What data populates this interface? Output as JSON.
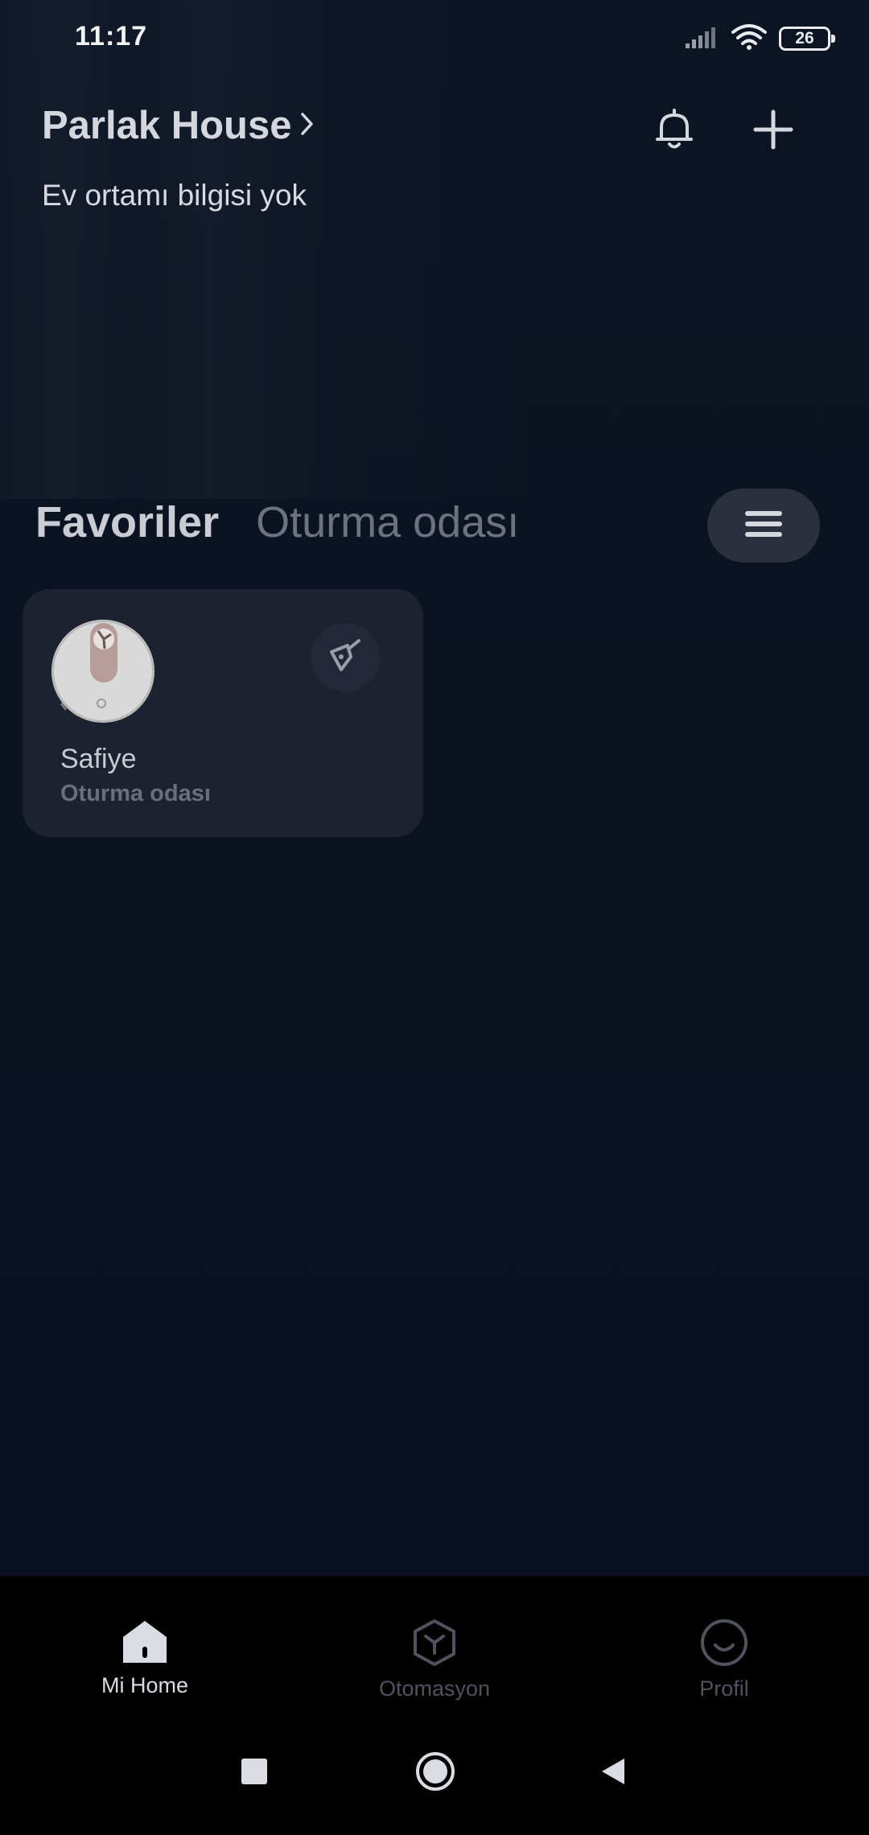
{
  "status_bar": {
    "time": "11:17",
    "battery_level": "26",
    "icons": [
      "signal-icon",
      "wifi-icon",
      "battery-icon"
    ]
  },
  "header": {
    "home_name": "Parlak House",
    "subtitle": "Ev ortamı bilgisi yok",
    "actions": [
      "bell-icon",
      "plus-icon"
    ]
  },
  "tabs": {
    "items": [
      {
        "label": "Favoriler",
        "active": true
      },
      {
        "label": "Oturma odası",
        "active": false
      }
    ],
    "menu_icon": "hamburger-icon"
  },
  "devices": [
    {
      "name": "Safiye",
      "room": "Oturma odası",
      "image": "robot-vacuum",
      "action_icon": "broom-icon"
    }
  ],
  "bottom_nav": {
    "items": [
      {
        "label": "Mi Home",
        "icon": "home-icon",
        "active": true
      },
      {
        "label": "Otomasyon",
        "icon": "cube-icon",
        "active": false
      },
      {
        "label": "Profil",
        "icon": "smile-icon",
        "active": false
      }
    ]
  },
  "system_nav": {
    "buttons": [
      "recents-square-icon",
      "home-circle-icon",
      "back-triangle-icon"
    ]
  },
  "colors": {
    "background": "#0b1322",
    "card": "#1d2230",
    "active_text": "#d4d7dd",
    "inactive_text": "#6c7280",
    "nav_background": "#000000"
  }
}
